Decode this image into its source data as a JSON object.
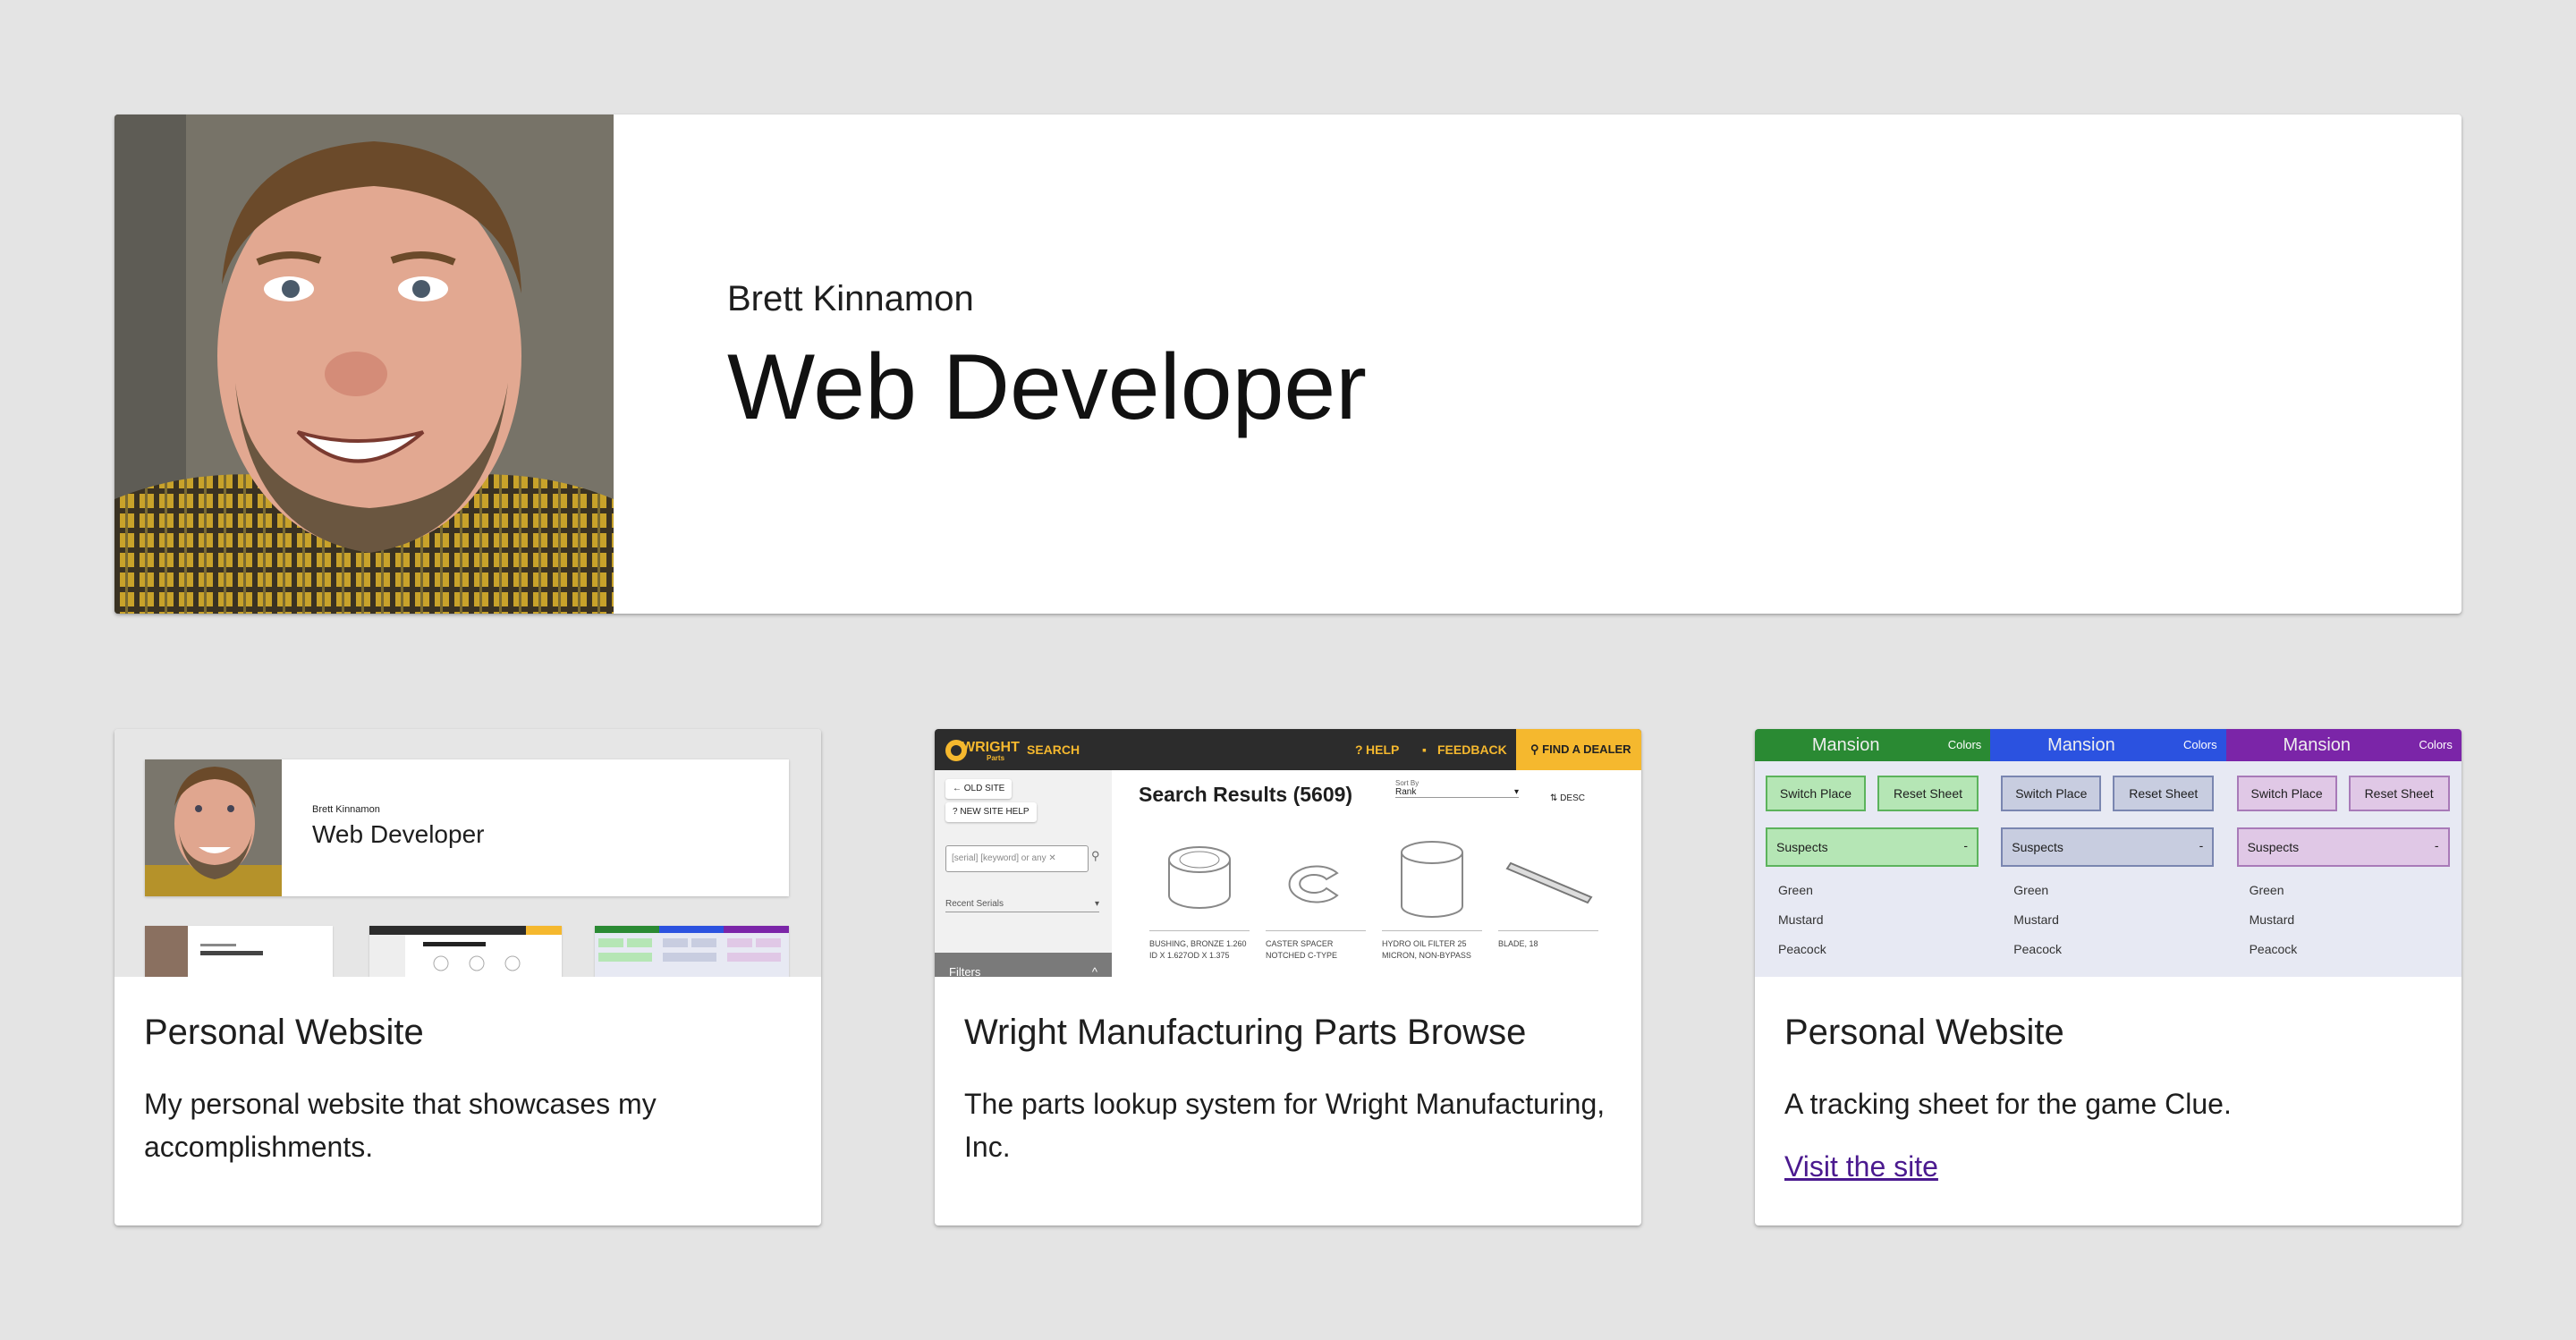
{
  "header": {
    "name": "Brett Kinnamon",
    "role": "Web Developer"
  },
  "projects": [
    {
      "title": "Personal Website",
      "description": "My personal website that showcases my accomplishments.",
      "thumb": {
        "name": "Brett Kinnamon",
        "role": "Web Developer"
      }
    },
    {
      "title": "Wright Manufacturing Parts Browse",
      "description": "The parts lookup system for Wright Manufacturing, Inc.",
      "thumb": {
        "logo": "WRIGHT",
        "logo_sub": "Parts",
        "search": "SEARCH",
        "help": "HELP",
        "feedback": "FEEDBACK",
        "dealer": "FIND A DEALER",
        "old_site": "OLD SITE",
        "new_site_help": "NEW SITE HELP",
        "search_placeholder": "[serial] [keyword] or any",
        "recent_serials": "Recent Serials",
        "filters": "Filters",
        "results": "Search Results (5609)",
        "sort_label": "Sort By",
        "sort_value": "Rank",
        "order": "DESC",
        "parts": [
          "BUSHING, BRONZE 1.260 ID X 1.627OD X 1.375",
          "CASTER SPACER NOTCHED C-TYPE",
          "HYDRO OIL FILTER 25 MICRON, NON-BYPASS",
          "BLADE, 18"
        ]
      }
    },
    {
      "title": "Personal Website",
      "description": "A tracking sheet for the game Clue.",
      "link": "Visit the site",
      "thumb": {
        "mansion": "Mansion",
        "colors": "Colors",
        "switch": "Switch Place",
        "reset": "Reset Sheet",
        "suspects": "Suspects",
        "list": [
          "Green",
          "Mustard",
          "Peacock"
        ],
        "themes": [
          "#2a8a33",
          "#2b52e0",
          "#7b25a8"
        ]
      }
    }
  ]
}
